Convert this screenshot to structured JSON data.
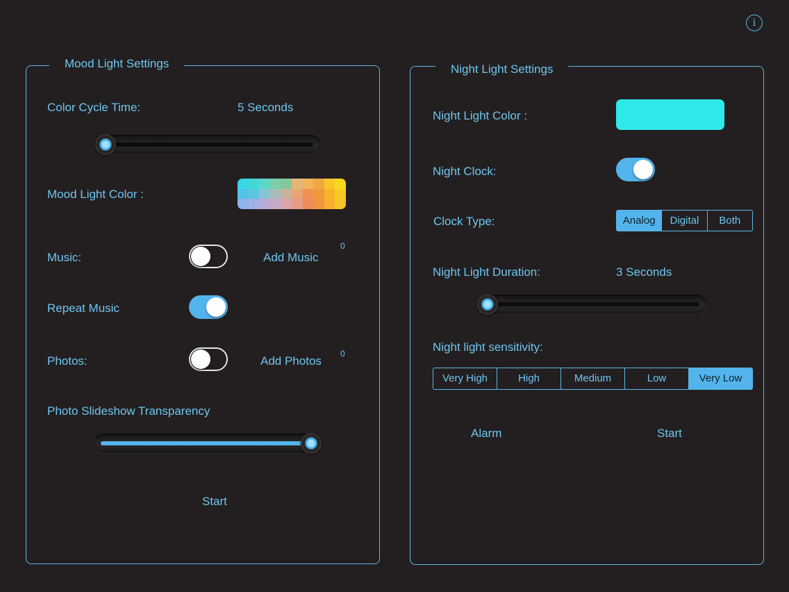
{
  "info_icon": "i",
  "mood": {
    "title": "Mood Light Settings",
    "color_cycle_label": "Color Cycle Time:",
    "color_cycle_value": "5 Seconds",
    "color_cycle_slider": 0.0,
    "mood_color_label": "Mood Light Color :",
    "mood_palette": [
      "#3ad6e3",
      "#44d9d6",
      "#5bd7c8",
      "#7ccfa8",
      "#84c89a",
      "#e7b677",
      "#f2b35c",
      "#f3a741",
      "#f7c62a",
      "#f9d91f",
      "#52c3e6",
      "#5fc6e0",
      "#88c4d4",
      "#a9bdbd",
      "#c9b39b",
      "#e9a577",
      "#f08f4e",
      "#f09a3b",
      "#f6b529",
      "#f7cb22",
      "#8fb3ec",
      "#a3b1e7",
      "#b7abd8",
      "#c6a8c8",
      "#d8a4ac",
      "#e79a86",
      "#ee8d5c",
      "#f19543",
      "#f5ae2d",
      "#f6c427"
    ],
    "music_label": "Music:",
    "music_on": false,
    "add_music_label": "Add Music",
    "music_count": "0",
    "repeat_label": "Repeat Music",
    "repeat_on": true,
    "photos_label": "Photos:",
    "photos_on": false,
    "add_photos_label": "Add Photos",
    "photos_count": "0",
    "transparency_label": "Photo Slideshow Transparency",
    "transparency_slider": 1.0,
    "start_label": "Start"
  },
  "night": {
    "title": "Night Light Settings",
    "color_label": "Night Light Color :",
    "color_value": "#2fe8e9",
    "clock_label": "Night Clock:",
    "clock_on": true,
    "clock_type_label": "Clock Type:",
    "clock_types": [
      "Analog",
      "Digital",
      "Both"
    ],
    "clock_type_selected": "Analog",
    "duration_label": "Night Light Duration:",
    "duration_value": "3 Seconds",
    "duration_slider": 0.0,
    "sensitivity_label": "Night light sensitivity:",
    "sensitivities": [
      "Very High",
      "High",
      "Medium",
      "Low",
      "Very Low"
    ],
    "sensitivity_selected": "Very Low",
    "alarm_label": "Alarm",
    "start_label": "Start"
  }
}
